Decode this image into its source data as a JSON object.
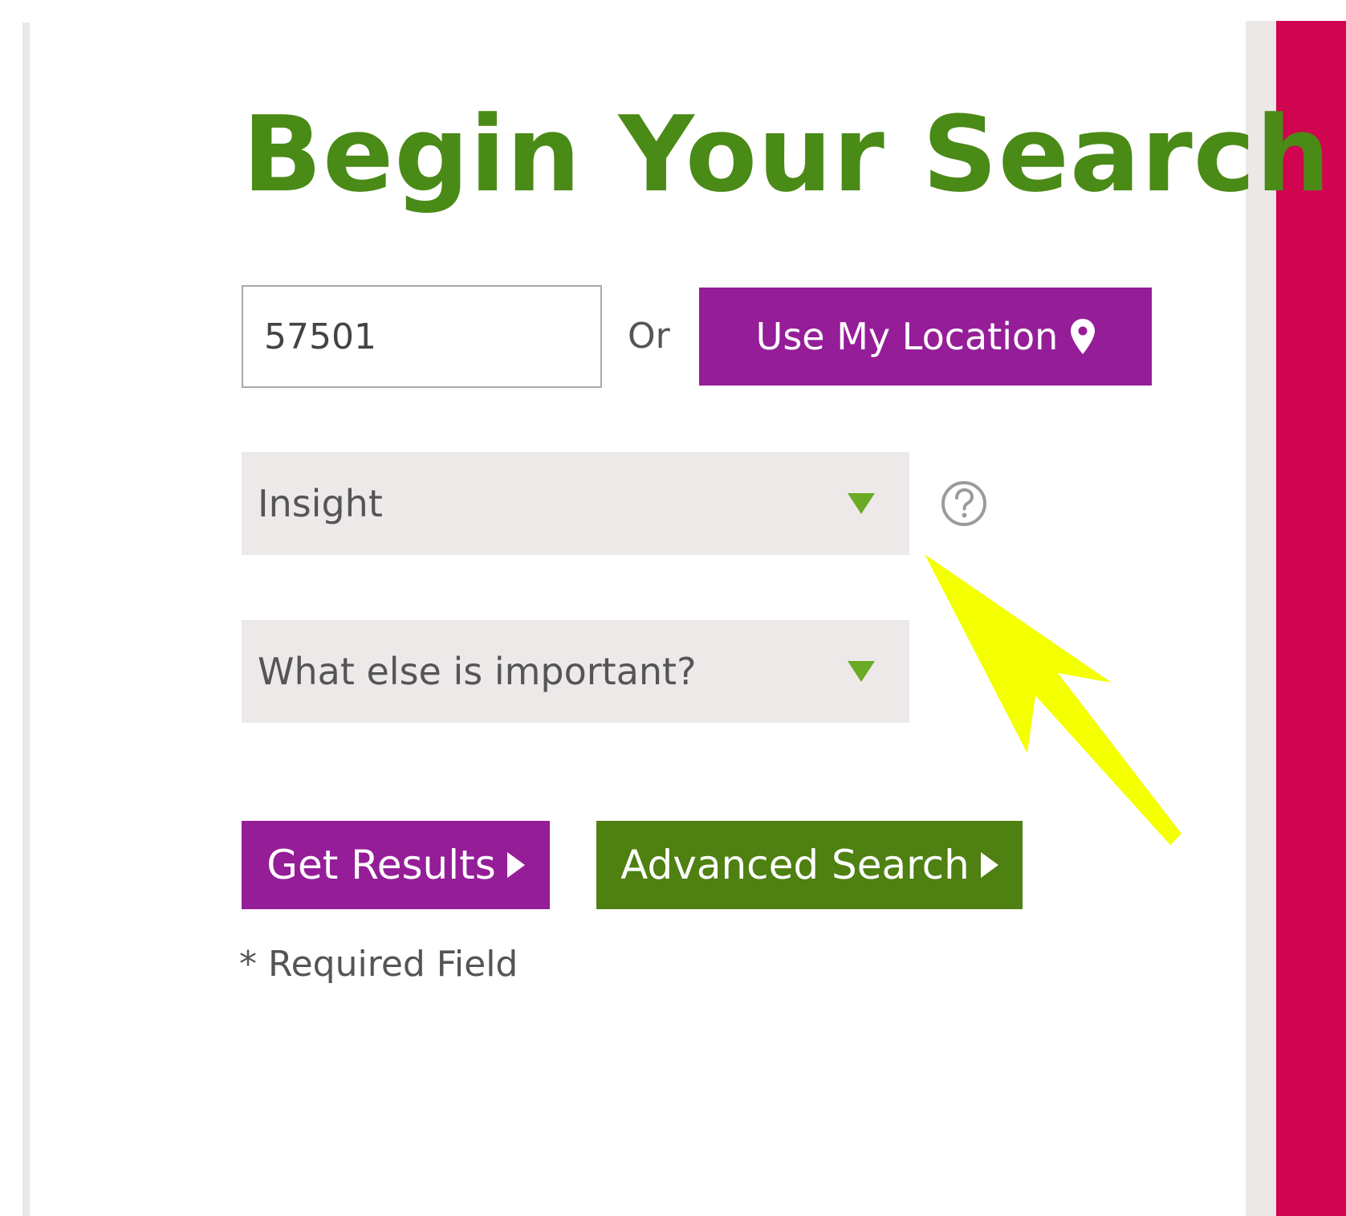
{
  "title": "Begin Your Search",
  "location": {
    "zip_value": "57501",
    "or_label": "Or",
    "use_location_label": "Use My Location"
  },
  "filters": {
    "primary_select_value": "Insight",
    "secondary_select_value": "What else is important?"
  },
  "actions": {
    "get_results_label": "Get Results",
    "advanced_search_label": "Advanced Search"
  },
  "required_note": "* Required Field",
  "icons": {
    "location": "map-pin-icon",
    "caret": "triangle-down-icon",
    "help": "question-circle-icon",
    "button_arrow": "triangle-right-icon"
  },
  "colors": {
    "title_green": "#4a8a17",
    "purple": "#951d98",
    "green_button": "#4e8012",
    "magenta_panel": "#d0044f",
    "select_bg": "#ede9e9",
    "annotation_yellow": "#f4ff00"
  }
}
